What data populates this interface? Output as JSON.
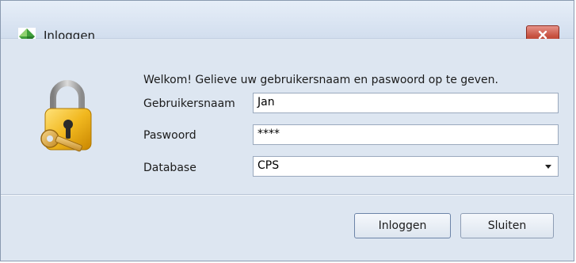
{
  "window": {
    "title": "Inloggen"
  },
  "icons": {
    "app": "app-logo-icon",
    "close": "close-icon",
    "lock": "padlock-key-icon",
    "dropdown": "chevron-down-icon"
  },
  "form": {
    "welcome": "Welkom! Gelieve uw gebruikersnaam en paswoord op te geven.",
    "username_label": "Gebruikersnaam",
    "username_value": "Jan",
    "password_label": "Paswoord",
    "password_value": "****",
    "database_label": "Database",
    "database_value": "CPS"
  },
  "buttons": {
    "login": "Inloggen",
    "close": "Sluiten"
  },
  "colors": {
    "accent_close": "#c85442",
    "app_icon": "#4caf50"
  }
}
